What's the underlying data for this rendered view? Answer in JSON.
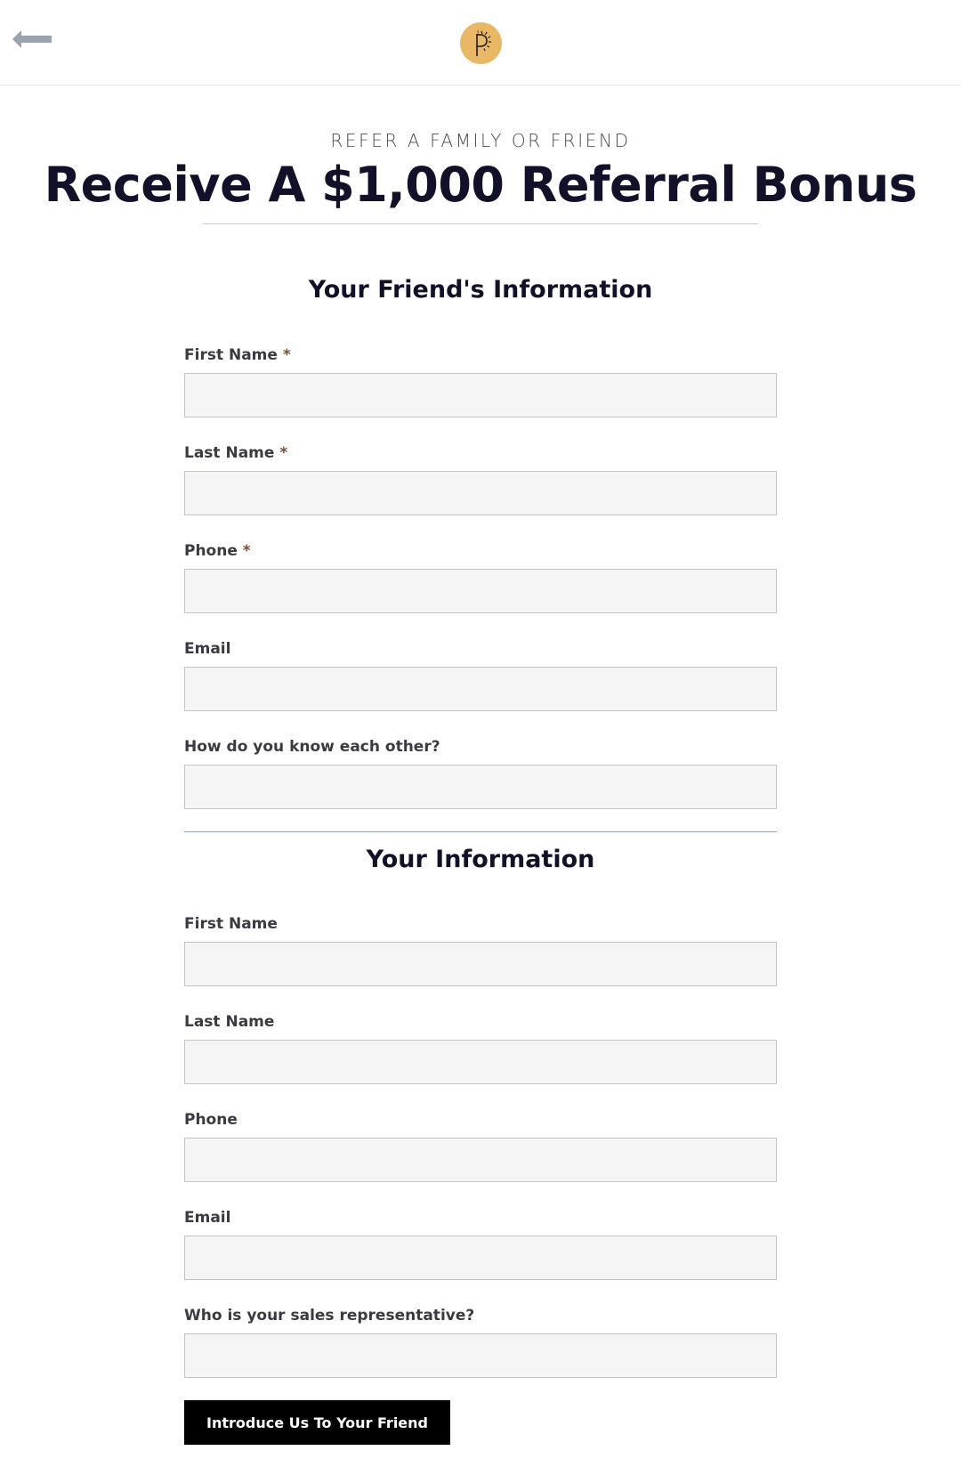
{
  "header": {
    "back_icon": "arrow-left-icon",
    "logo_letter": "P",
    "logo_icon": "sun-p-logo-icon",
    "colors": {
      "logo_bg": "#e9b866",
      "border": "#efe6d2"
    }
  },
  "hero": {
    "eyebrow": "REFER A FAMILY OR FRIEND",
    "title": "Receive A $1,000 Referral Bonus"
  },
  "friend_section": {
    "title": "Your Friend's Information",
    "fields": [
      {
        "label": "First Name",
        "required": "*",
        "value": "",
        "placeholder": ""
      },
      {
        "label": "Last Name",
        "required": "*",
        "value": "",
        "placeholder": ""
      },
      {
        "label": "Phone",
        "required": "*",
        "value": "",
        "placeholder": ""
      },
      {
        "label": "Email",
        "required": "",
        "value": "",
        "placeholder": ""
      },
      {
        "label": "How do you know each other?",
        "required": "",
        "value": "",
        "placeholder": ""
      }
    ]
  },
  "your_section": {
    "title": "Your Information",
    "fields": [
      {
        "label": "First Name",
        "value": "",
        "placeholder": ""
      },
      {
        "label": "Last Name",
        "value": "",
        "placeholder": ""
      },
      {
        "label": "Phone",
        "value": "",
        "placeholder": ""
      },
      {
        "label": "Email",
        "value": "",
        "placeholder": ""
      },
      {
        "label": "Who is your sales representative?",
        "value": "",
        "placeholder": ""
      }
    ]
  },
  "submit": {
    "label": "Introduce Us To Your Friend",
    "color": "#000000"
  }
}
